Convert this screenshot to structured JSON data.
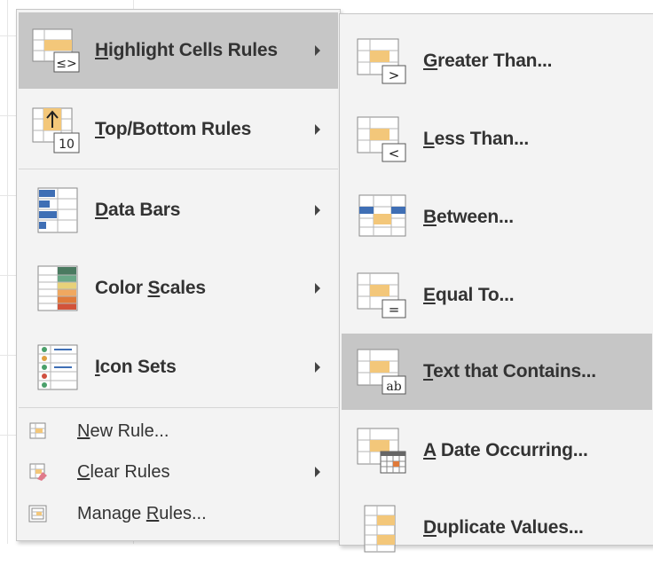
{
  "main_menu": {
    "items": [
      {
        "mn": "H",
        "rest": "ighlight Cells Rules",
        "icon": "highlight-cells-rules-icon",
        "submenu": true,
        "highlighted": true
      },
      {
        "mn": "T",
        "rest": "op/Bottom Rules",
        "icon": "top-bottom-rules-icon",
        "submenu": true,
        "highlighted": false
      },
      {
        "mn": "D",
        "rest": "ata Bars",
        "icon": "data-bars-icon",
        "submenu": true,
        "highlighted": false
      },
      {
        "pre": "Color ",
        "mn": "S",
        "rest": "cales",
        "icon": "color-scales-icon",
        "submenu": true,
        "highlighted": false
      },
      {
        "mn": "I",
        "rest": "con Sets",
        "icon": "icon-sets-icon",
        "submenu": true,
        "highlighted": false
      }
    ],
    "small_items": [
      {
        "mn": "N",
        "rest": "ew Rule...",
        "icon": "new-rule-icon",
        "submenu": false
      },
      {
        "mn": "C",
        "rest": "lear Rules",
        "icon": "clear-rules-icon",
        "submenu": true
      },
      {
        "pre": "Manage ",
        "mn": "R",
        "rest": "ules...",
        "icon": "manage-rules-icon",
        "submenu": false
      }
    ]
  },
  "sub_menu": {
    "items": [
      {
        "mn": "G",
        "rest": "reater Than...",
        "icon": "greater-than-icon",
        "badge": ">",
        "highlighted": false
      },
      {
        "mn": "L",
        "rest": "ess Than...",
        "icon": "less-than-icon",
        "badge": "<",
        "highlighted": false
      },
      {
        "mn": "B",
        "rest": "etween...",
        "icon": "between-icon",
        "badge": "",
        "highlighted": false
      },
      {
        "mn": "E",
        "rest": "qual To...",
        "icon": "equal-to-icon",
        "badge": "=",
        "highlighted": false
      },
      {
        "mn": "T",
        "rest": "ext that Contains...",
        "icon": "text-contains-icon",
        "badge": "ab",
        "highlighted": true
      },
      {
        "mn": "A",
        "rest": " Date Occurring...",
        "icon": "date-occurring-icon",
        "badge": "",
        "highlighted": false
      },
      {
        "mn": "D",
        "rest": "uplicate Values...",
        "icon": "duplicate-values-icon",
        "badge": "",
        "highlighted": false
      }
    ]
  },
  "icon_badges": {
    "highlight": "≤>",
    "top_bottom": "10"
  },
  "colors": {
    "menu_bg": "#f3f3f3",
    "highlight": "#c6c6c6",
    "cell_fill": "#f3c77a",
    "bar_blue": "#3f6fb5"
  }
}
